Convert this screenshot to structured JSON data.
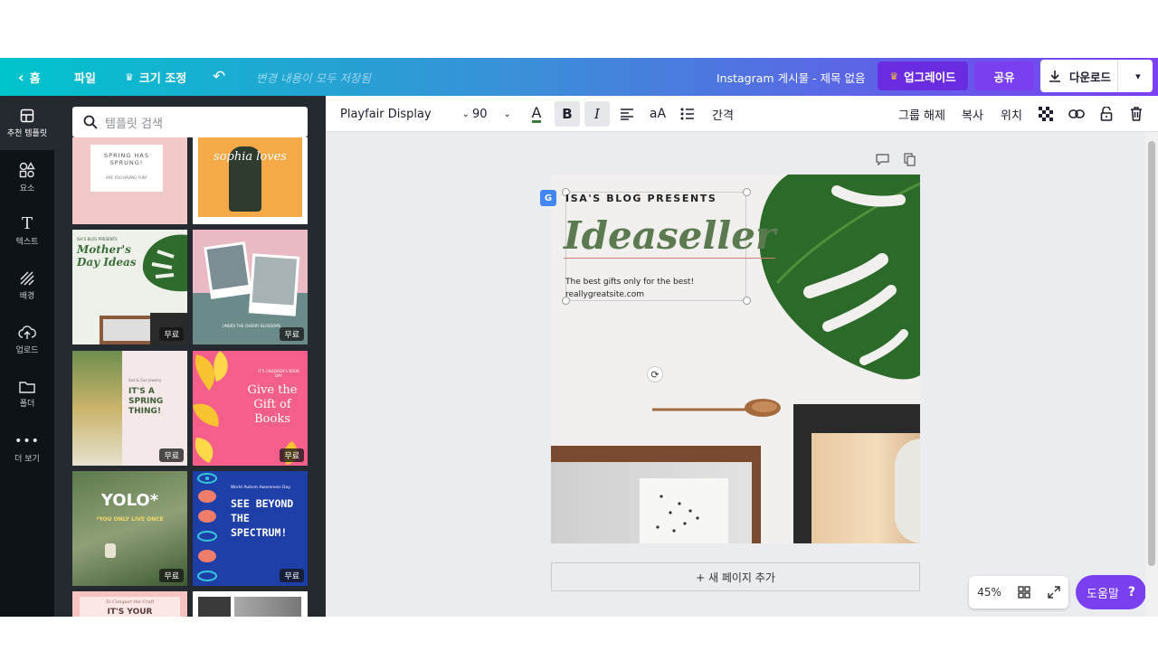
{
  "topbar": {
    "home_label": "홈",
    "file_label": "파일",
    "resize_label": "크기 조정",
    "saved_status": "변경 내용이 모두 저장됨",
    "doc_title": "Instagram 게시물 - 제목 없음",
    "upgrade_label": "업그레이드",
    "share_label": "공유",
    "download_label": "다운로드"
  },
  "rail": {
    "items": [
      {
        "label": "추천 템플릿",
        "icon": "layout-icon"
      },
      {
        "label": "요소",
        "icon": "shapes-icon"
      },
      {
        "label": "텍스트",
        "icon": "text-icon"
      },
      {
        "label": "배경",
        "icon": "background-icon"
      },
      {
        "label": "업로드",
        "icon": "upload-cloud-icon"
      },
      {
        "label": "폴더",
        "icon": "folder-icon"
      },
      {
        "label": "더 보기",
        "icon": "more-dots-icon"
      }
    ]
  },
  "panel": {
    "search_placeholder": "템플릿 검색",
    "free_badge": "무료",
    "templates": [
      {
        "text": "SPRING HAS SPRUNG!",
        "sub": "ARE YOU HAVING FUN?"
      },
      {
        "text": "sophia loves"
      },
      {
        "text": "Mother's Day Ideas",
        "sub": "ISA'S BLOG PRESENTS"
      },
      {
        "text": "UNDER THE CHERRY BLOSSOMS"
      },
      {
        "text": "IT'S A SPRING THING!",
        "sub": "Sad & Sue Jewelry"
      },
      {
        "text": "Give the Gift of Books",
        "sub": "IT'S CHILDREN'S BOOK DAY"
      },
      {
        "text": "YOLO*",
        "sub": "*YOU ONLY LIVE ONCE"
      },
      {
        "text": "SEE BEYOND THE SPECTRUM!",
        "sub": "World Autism Awareness Day"
      },
      {
        "text": "IT'S YOUR",
        "sub": "To Conquer the Craft"
      },
      {
        "text": ""
      }
    ]
  },
  "toolbar": {
    "font_name": "Playfair Display",
    "font_size": "90",
    "ungroup_label": "그룹 해제",
    "copy_label": "복사",
    "position_label": "위치",
    "spacing_label": "간격"
  },
  "design": {
    "kicker": "ISA'S BLOG PRESENTS",
    "headline": "Ideaseller",
    "tagline": "The best gifts only for the best!",
    "website": "reallygreatsite.com"
  },
  "canvas": {
    "add_page_label": "+ 새 페이지 추가",
    "zoom": "45%",
    "help_label": "도움말",
    "help_icon": "?"
  },
  "colors": {
    "accent_purple": "#7b3ff2",
    "header_start": "#00c4cc",
    "headline_green": "#5b7a4f"
  }
}
